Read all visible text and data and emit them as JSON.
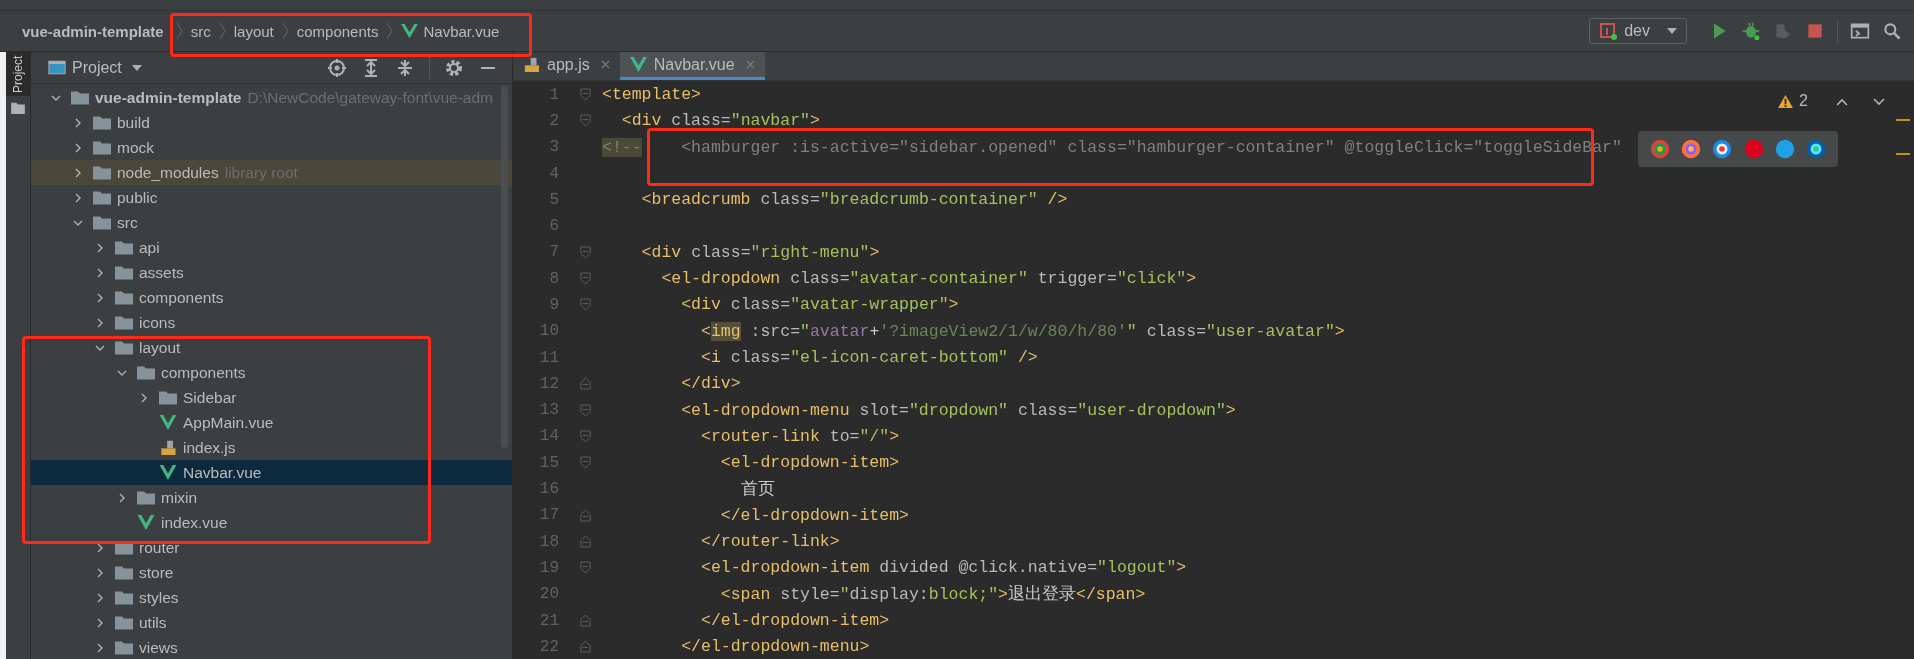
{
  "breadcrumb": [
    {
      "label": "vue-admin-template",
      "kind": "project"
    },
    {
      "label": "src",
      "kind": "folder"
    },
    {
      "label": "layout",
      "kind": "folder"
    },
    {
      "label": "components",
      "kind": "folder"
    },
    {
      "label": "Navbar.vue",
      "kind": "vue"
    }
  ],
  "toolbar": {
    "configuration": "dev",
    "buttons": [
      {
        "kind": "run",
        "disabled": false
      },
      {
        "kind": "debug",
        "disabled": false
      },
      {
        "kind": "coverage",
        "disabled": true
      },
      {
        "kind": "stop",
        "disabled": false
      },
      {
        "kind": "terminal",
        "disabled": false
      },
      {
        "kind": "search",
        "disabled": false
      }
    ]
  },
  "side_strip": {
    "label": "Project"
  },
  "project_panel": {
    "title": "Project",
    "tools": [
      {
        "kind": "locate"
      },
      {
        "kind": "expand"
      },
      {
        "kind": "collapse"
      },
      {
        "kind": "settings"
      },
      {
        "kind": "hide"
      }
    ]
  },
  "tree": [
    {
      "name": "vue-admin-template",
      "kind": "folder",
      "path": "D:\\NewCode\\gateway-font\\vue-adm",
      "expanded": true,
      "selected": false,
      "children": [
        {
          "name": "build",
          "kind": "folder",
          "expanded": false,
          "selected": false
        },
        {
          "name": "mock",
          "kind": "folder",
          "expanded": false,
          "selected": false
        },
        {
          "name": "node_modules",
          "kind": "library",
          "note": "library root",
          "expanded": false,
          "selected": false
        },
        {
          "name": "public",
          "kind": "folder",
          "expanded": false,
          "selected": false
        },
        {
          "name": "src",
          "kind": "folder",
          "expanded": true,
          "selected": false,
          "children": [
            {
              "name": "api",
              "kind": "folder",
              "expanded": false,
              "selected": false
            },
            {
              "name": "assets",
              "kind": "folder",
              "expanded": false,
              "selected": false
            },
            {
              "name": "components",
              "kind": "folder",
              "expanded": false,
              "selected": false
            },
            {
              "name": "icons",
              "kind": "folder",
              "expanded": false,
              "selected": false
            },
            {
              "name": "layout",
              "kind": "folder",
              "expanded": true,
              "selected": false,
              "children": [
                {
                  "name": "components",
                  "kind": "folder",
                  "expanded": true,
                  "selected": false,
                  "children": [
                    {
                      "name": "Sidebar",
                      "kind": "folder",
                      "expanded": false,
                      "selected": false
                    },
                    {
                      "name": "AppMain.vue",
                      "kind": "vue",
                      "selected": false
                    },
                    {
                      "name": "index.js",
                      "kind": "js",
                      "selected": false
                    },
                    {
                      "name": "Navbar.vue",
                      "kind": "vue",
                      "selected": true
                    }
                  ]
                },
                {
                  "name": "mixin",
                  "kind": "folder",
                  "expanded": false,
                  "selected": false
                },
                {
                  "name": "index.vue",
                  "kind": "vue",
                  "selected": false
                }
              ]
            },
            {
              "name": "router",
              "kind": "folder",
              "expanded": false,
              "selected": false
            },
            {
              "name": "store",
              "kind": "folder",
              "expanded": false,
              "selected": false
            },
            {
              "name": "styles",
              "kind": "folder",
              "expanded": false,
              "selected": false
            },
            {
              "name": "utils",
              "kind": "folder",
              "expanded": false,
              "selected": false
            },
            {
              "name": "views",
              "kind": "folder",
              "expanded": false,
              "selected": false
            }
          ]
        }
      ]
    }
  ],
  "tabs": [
    {
      "label": "app.js",
      "kind": "js",
      "selected": false
    },
    {
      "label": "Navbar.vue",
      "kind": "vue",
      "selected": true
    }
  ],
  "editor": {
    "warnings": "2",
    "lines": [
      {
        "number": "1",
        "kind": "fold-open",
        "tokens": [
          {
            "kind": "tag",
            "text": "<template>"
          }
        ]
      },
      {
        "number": "2",
        "kind": "fold-open",
        "tokens": [
          {
            "kind": "tag",
            "text": "  <div "
          },
          {
            "kind": "attr",
            "text": "class="
          },
          {
            "kind": "value",
            "text": "\"navbar\""
          },
          {
            "kind": "tag",
            "text": ">"
          }
        ]
      },
      {
        "number": "3",
        "tokens": [
          {
            "kind": "comment-mark",
            "text": "<!--"
          },
          {
            "kind": "comment",
            "text": "    <hamburger :is-active=\"sidebar.opened\" class=\"hamburger-container\" @toggleClick=\"toggleSideBar\""
          }
        ]
      },
      {
        "number": "4"
      },
      {
        "number": "5",
        "tokens": [
          {
            "kind": "tag",
            "text": "    <breadcrumb "
          },
          {
            "kind": "attr",
            "text": "class="
          },
          {
            "kind": "value",
            "text": "\"breadcrumb-container\""
          },
          {
            "kind": "tag",
            "text": " />"
          }
        ]
      },
      {
        "number": "6"
      },
      {
        "number": "7",
        "kind": "fold-open",
        "tokens": [
          {
            "kind": "tag",
            "text": "    <div "
          },
          {
            "kind": "attr",
            "text": "class="
          },
          {
            "kind": "value",
            "text": "\"right-menu\""
          },
          {
            "kind": "tag",
            "text": ">"
          }
        ]
      },
      {
        "number": "8",
        "kind": "fold-open",
        "tokens": [
          {
            "kind": "tag",
            "text": "      <el-dropdown "
          },
          {
            "kind": "attr",
            "text": "class="
          },
          {
            "kind": "value",
            "text": "\"avatar-container\""
          },
          {
            "kind": "attr",
            "text": " trigger="
          },
          {
            "kind": "value",
            "text": "\"click\""
          },
          {
            "kind": "tag",
            "text": ">"
          }
        ]
      },
      {
        "number": "9",
        "kind": "fold-open",
        "tokens": [
          {
            "kind": "tag",
            "text": "        <div "
          },
          {
            "kind": "attr",
            "text": "class="
          },
          {
            "kind": "value",
            "text": "\"avatar-wrapper\""
          },
          {
            "kind": "tag",
            "text": ">"
          }
        ]
      },
      {
        "number": "10",
        "tokens": [
          {
            "kind": "tag",
            "text": "          <"
          },
          {
            "kind": "tag-match",
            "text": "img"
          },
          {
            "kind": "attr",
            "text": " :src="
          },
          {
            "kind": "value",
            "text": "\""
          },
          {
            "kind": "var",
            "text": "avatar"
          },
          {
            "kind": "text",
            "text": "+"
          },
          {
            "kind": "string",
            "text": "'?imageView2/1/w/80/h/80'"
          },
          {
            "kind": "value",
            "text": "\""
          },
          {
            "kind": "attr",
            "text": " class="
          },
          {
            "kind": "value",
            "text": "\"user-avatar\""
          },
          {
            "kind": "tag",
            "text": ">"
          }
        ]
      },
      {
        "number": "11",
        "tokens": [
          {
            "kind": "tag",
            "text": "          <i "
          },
          {
            "kind": "attr",
            "text": "class="
          },
          {
            "kind": "value",
            "text": "\"el-icon-caret-bottom\""
          },
          {
            "kind": "tag",
            "text": " />"
          }
        ]
      },
      {
        "number": "12",
        "kind": "fold-close",
        "tokens": [
          {
            "kind": "tag",
            "text": "        </div>"
          }
        ]
      },
      {
        "number": "13",
        "kind": "fold-open",
        "tokens": [
          {
            "kind": "tag",
            "text": "        <el-dropdown-menu "
          },
          {
            "kind": "attr",
            "text": "slot="
          },
          {
            "kind": "value",
            "text": "\"dropdown\""
          },
          {
            "kind": "attr",
            "text": " class="
          },
          {
            "kind": "value",
            "text": "\"user-dropdown\""
          },
          {
            "kind": "tag",
            "text": ">"
          }
        ]
      },
      {
        "number": "14",
        "kind": "fold-open",
        "tokens": [
          {
            "kind": "tag",
            "text": "          <router-link "
          },
          {
            "kind": "attr",
            "text": "to="
          },
          {
            "kind": "value",
            "text": "\"/\""
          },
          {
            "kind": "tag",
            "text": ">"
          }
        ]
      },
      {
        "number": "15",
        "kind": "fold-open",
        "tokens": [
          {
            "kind": "tag",
            "text": "            <el-dropdown-item>"
          }
        ]
      },
      {
        "number": "16",
        "tokens": [
          {
            "kind": "text",
            "text": "              首页"
          }
        ]
      },
      {
        "number": "17",
        "kind": "fold-close",
        "tokens": [
          {
            "kind": "tag",
            "text": "            </el-dropdown-item>"
          }
        ]
      },
      {
        "number": "18",
        "kind": "fold-close",
        "tokens": [
          {
            "kind": "tag",
            "text": "          </router-link>"
          }
        ]
      },
      {
        "number": "19",
        "kind": "fold-open",
        "tokens": [
          {
            "kind": "tag",
            "text": "          <el-dropdown-item "
          },
          {
            "kind": "attr",
            "text": "divided @click.native="
          },
          {
            "kind": "value",
            "text": "\"logout\""
          },
          {
            "kind": "tag",
            "text": ">"
          }
        ]
      },
      {
        "number": "20",
        "tokens": [
          {
            "kind": "tag",
            "text": "            <span "
          },
          {
            "kind": "attr",
            "text": "style="
          },
          {
            "kind": "value",
            "text": "\""
          },
          {
            "kind": "attr",
            "text": "display:"
          },
          {
            "kind": "value",
            "text": "block;\""
          },
          {
            "kind": "tag",
            "text": ">"
          },
          {
            "kind": "text",
            "text": "退出登录"
          },
          {
            "kind": "tag",
            "text": "</span>"
          }
        ]
      },
      {
        "number": "21",
        "kind": "fold-close",
        "tokens": [
          {
            "kind": "tag",
            "text": "          </el-dropdown-item>"
          }
        ]
      },
      {
        "number": "22",
        "kind": "fold-close",
        "tokens": [
          {
            "kind": "tag",
            "text": "        </el-dropdown-menu>"
          }
        ]
      }
    ]
  },
  "annotations": [
    {
      "kind": "breadcrumb"
    },
    {
      "kind": "code"
    },
    {
      "kind": "tree"
    }
  ]
}
